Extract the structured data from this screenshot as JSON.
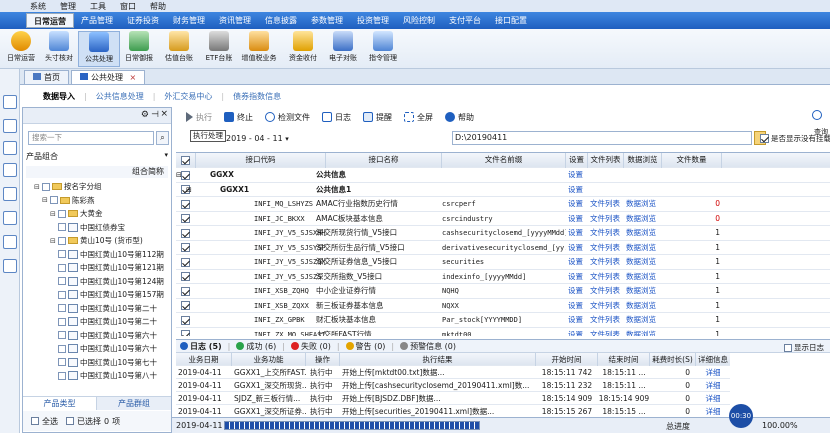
{
  "window": {
    "menu": [
      "系统",
      "管理",
      "工具",
      "窗口",
      "帮助"
    ]
  },
  "main_menu": [
    "日常运营",
    "产品管理",
    "证券投资",
    "财务管理",
    "资讯管理",
    "信息披露",
    "参数管理",
    "投资管理",
    "风险控制",
    "支付平台",
    "接口配置"
  ],
  "ribbon": [
    "日常运营",
    "头寸核对",
    "公共处理",
    "日常御报",
    "估值台账",
    "ETF台账",
    "增值税业务",
    "资金收付",
    "电子对账",
    "指令管理"
  ],
  "tabs": [
    "首页",
    "公共处理"
  ],
  "subtabs": [
    "数据导入",
    "公共信息处理",
    "外汇交易中心",
    "债券指数信息"
  ],
  "left": {
    "search_placeholder": "搜索一下",
    "group_label": "产品组合",
    "column": "组合简称",
    "tree": [
      {
        "label": "按名字分组",
        "indent": 1
      },
      {
        "label": "陈彩燕",
        "indent": 2
      },
      {
        "label": "大黄金",
        "indent": 3
      },
      {
        "label": "中国红债券宝",
        "indent": 4
      },
      {
        "label": "黄山10号 (货币型)",
        "indent": 3
      },
      {
        "label": "中国红黄山10号第112期",
        "indent": 4
      },
      {
        "label": "中国红黄山10号第121期",
        "indent": 4
      },
      {
        "label": "中国红黄山10号第124期",
        "indent": 4
      },
      {
        "label": "中国红黄山10号第157期",
        "indent": 4
      },
      {
        "label": "中国红黄山10号第二十",
        "indent": 4
      },
      {
        "label": "中国红黄山10号第二十",
        "indent": 4
      },
      {
        "label": "中国红黄山10号第六十",
        "indent": 4
      },
      {
        "label": "中国红黄山10号第六十",
        "indent": 4
      },
      {
        "label": "中国红黄山10号第七十",
        "indent": 4
      },
      {
        "label": "中国红黄山10号第八十",
        "indent": 4
      }
    ],
    "tabs": [
      "产品类型",
      "产品群组"
    ],
    "footer": {
      "select_all": "全选",
      "selected": "已选择",
      "count": "0",
      "unit": "项"
    }
  },
  "toolbar": {
    "buttons": [
      "执行",
      "终止",
      "检测文件",
      "日志",
      "提醒",
      "全屏",
      "帮助"
    ],
    "query": "查询",
    "tooltip": "执行处理",
    "date": "2019 - 04 - 11",
    "path": "D:\\20190411",
    "show_all": "是否显示没有挂载"
  },
  "grid": {
    "headers": [
      "接口代码",
      "接口名称",
      "文件名前缀",
      "设置",
      "文件列表",
      "数据浏览",
      "文件数量"
    ],
    "rows": [
      {
        "code": "GGXX",
        "name": "公共信息",
        "prefix": "",
        "set": "设置",
        "list": "",
        "browse": "",
        "count": "",
        "level": 0
      },
      {
        "code": "GGXX1",
        "name": "公共信息1",
        "prefix": "",
        "set": "设置",
        "list": "",
        "browse": "",
        "count": "",
        "level": 1
      },
      {
        "code": "INFI_MQ_LSHYZS",
        "name": "AMAC行业指数历史行情",
        "prefix": "csrcperf",
        "set": "设置",
        "list": "文件列表",
        "browse": "数据浏览",
        "count": "0",
        "level": 2
      },
      {
        "code": "INFI_JC_BKXX",
        "name": "AMAC板块基本信息",
        "prefix": "csrcindustry",
        "set": "设置",
        "list": "文件列表",
        "browse": "数据浏览",
        "count": "0",
        "level": 2
      },
      {
        "code": "INFI_JY_V5_SJSXHHQ",
        "name": "深交所现货行情_V5接口",
        "prefix": "cashsecurityclosemd_[yyyyMMdd]",
        "set": "设置",
        "list": "文件列表",
        "browse": "数据浏览",
        "count": "1",
        "level": 2
      },
      {
        "code": "INFI_JY_V5_SJSYSPHQ",
        "name": "深交所衍生品行情_V5接口",
        "prefix": "derivativesecurityclosemd_[yy...",
        "set": "设置",
        "list": "文件列表",
        "browse": "数据浏览",
        "count": "1",
        "level": 2
      },
      {
        "code": "INFI_JY_V5_SJSZQXX",
        "name": "深交所证券信息_V5接口",
        "prefix": "securities",
        "set": "设置",
        "list": "文件列表",
        "browse": "数据浏览",
        "count": "1",
        "level": 2
      },
      {
        "code": "INFI_JY_V5_SJSZS",
        "name": "深交所指数_V5接口",
        "prefix": "indexinfo_[yyyyMMdd]",
        "set": "设置",
        "list": "文件列表",
        "browse": "数据浏览",
        "count": "1",
        "level": 2
      },
      {
        "code": "INFI_XSB_ZQHQ",
        "name": "中小企业证券行情",
        "prefix": "NQHQ",
        "set": "设置",
        "list": "文件列表",
        "browse": "数据浏览",
        "count": "1",
        "level": 2
      },
      {
        "code": "INFI_XSB_ZQXX",
        "name": "新三板证券基本信息",
        "prefix": "NQXX",
        "set": "设置",
        "list": "文件列表",
        "browse": "数据浏览",
        "count": "1",
        "level": 2
      },
      {
        "code": "INFI_ZX_GPBK",
        "name": "财汇板块基本信息",
        "prefix": "Par_stock[YYYYMMDD]",
        "set": "设置",
        "list": "文件列表",
        "browse": "数据浏览",
        "count": "1",
        "level": 2
      },
      {
        "code": "INFI_ZX_MQ_SHFAST",
        "name": "上交所FAST行情",
        "prefix": "mktdt00",
        "set": "设置",
        "list": "文件列表",
        "browse": "数据浏览",
        "count": "1",
        "level": 2
      }
    ]
  },
  "log": {
    "tabs": [
      {
        "label": "日志 (5)",
        "color": "#1f5fbf"
      },
      {
        "label": "成功 (6)",
        "color": "#2aa34a"
      },
      {
        "label": "失败 (0)",
        "color": "#d22"
      },
      {
        "label": "警告 (0)",
        "color": "#e3a400"
      },
      {
        "label": "预警信息 (0)",
        "color": "#888"
      }
    ],
    "show_log": "显示日志",
    "headers": [
      "业务日期",
      "业务功能",
      "操作",
      "执行结果",
      "开始时间",
      "结束时间",
      "耗费时长(S)",
      "详细信息"
    ],
    "rows": [
      {
        "date": "2019-04-11",
        "func": "GGXX1_上交所FAST...",
        "op": "执行中",
        "result": "开始上传[mktdt00.txt]数据...",
        "start": "18:15:11 742",
        "end": "18:15:11 ...",
        "dur": "0",
        "detail": "详细"
      },
      {
        "date": "2019-04-11",
        "func": "GGXX1_深交所现货...",
        "op": "执行中",
        "result": "开始上传[cashsecurityclosemd_20190411.xml]数...",
        "start": "18:15:11 232",
        "end": "18:15:11 ...",
        "dur": "0",
        "detail": "详细"
      },
      {
        "date": "2019-04-11",
        "func": "SJDZ_新三板行情...",
        "op": "执行中",
        "result": "开始上传[BJSDZ.DBF]数据...",
        "start": "18:15:14 909",
        "end": "18:15:14 909",
        "dur": "0",
        "detail": "详细"
      },
      {
        "date": "2019-04-11",
        "func": "GGXX1_深交所证券...",
        "op": "执行中",
        "result": "开始上传[securities_20190411.xml]数据...",
        "start": "18:15:15 267",
        "end": "18:15:15 ...",
        "dur": "0",
        "detail": "详细"
      }
    ]
  },
  "status": {
    "date": "2019-04-11",
    "progress_label": "总进度",
    "progress": "100.00%",
    "badge": "00:30"
  }
}
